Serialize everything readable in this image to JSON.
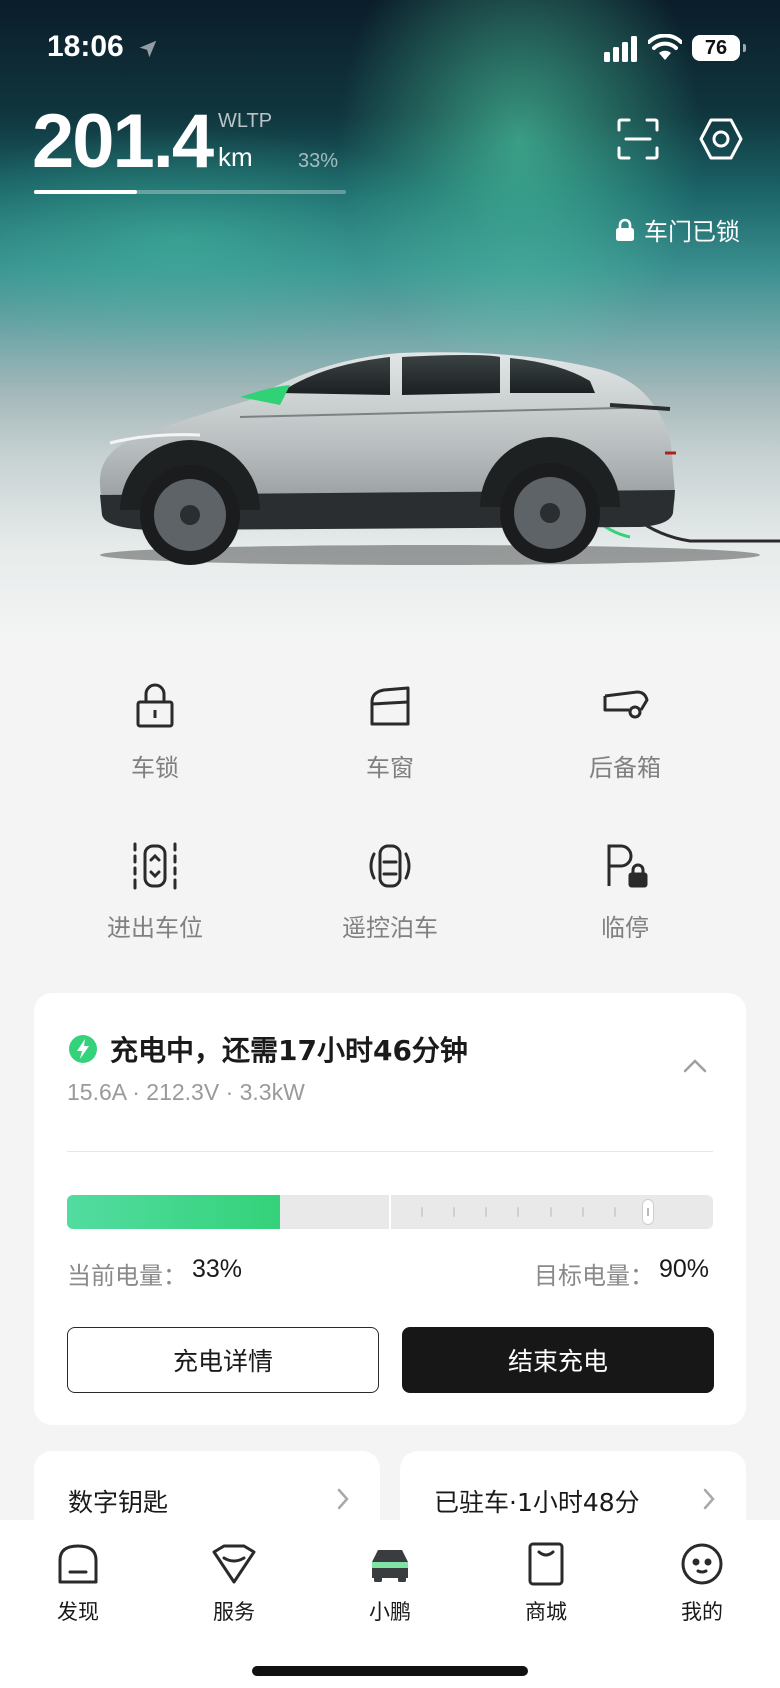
{
  "status_bar": {
    "time": "18:06",
    "battery": "76"
  },
  "range": {
    "value": "201.4",
    "standard": "WLTP",
    "unit": "km",
    "percent": "33%",
    "percent_value": 33
  },
  "door_status": "车门已锁",
  "controls": [
    {
      "label": "车锁",
      "icon": "lock-icon"
    },
    {
      "label": "车窗",
      "icon": "window-icon"
    },
    {
      "label": "后备箱",
      "icon": "trunk-icon"
    },
    {
      "label": "进出车位",
      "icon": "park-in-out-icon"
    },
    {
      "label": "遥控泊车",
      "icon": "remote-parking-icon"
    },
    {
      "label": "临停",
      "icon": "temporary-parking-icon"
    }
  ],
  "charging": {
    "title": "充电中，还需17小时46分钟",
    "metrics": "15.6A · 212.3V · 3.3kW",
    "current_label": "当前电量：",
    "current_value": "33%",
    "current_level": 33,
    "target_label": "目标电量：",
    "target_value": "90%",
    "target_level": 90,
    "details_button": "充电详情",
    "stop_button": "结束充电"
  },
  "cards": {
    "digital_key": "数字钥匙",
    "parked": "已驻车·1小时48分"
  },
  "tabs": [
    {
      "label": "发现",
      "icon": "discover-icon"
    },
    {
      "label": "服务",
      "icon": "service-icon"
    },
    {
      "label": "小鹏",
      "icon": "car-icon"
    },
    {
      "label": "商城",
      "icon": "shop-icon"
    },
    {
      "label": "我的",
      "icon": "profile-icon"
    }
  ],
  "colors": {
    "accent_green": "#34d27a",
    "dark_button": "#171717",
    "page_background": "#f4f4f5"
  }
}
